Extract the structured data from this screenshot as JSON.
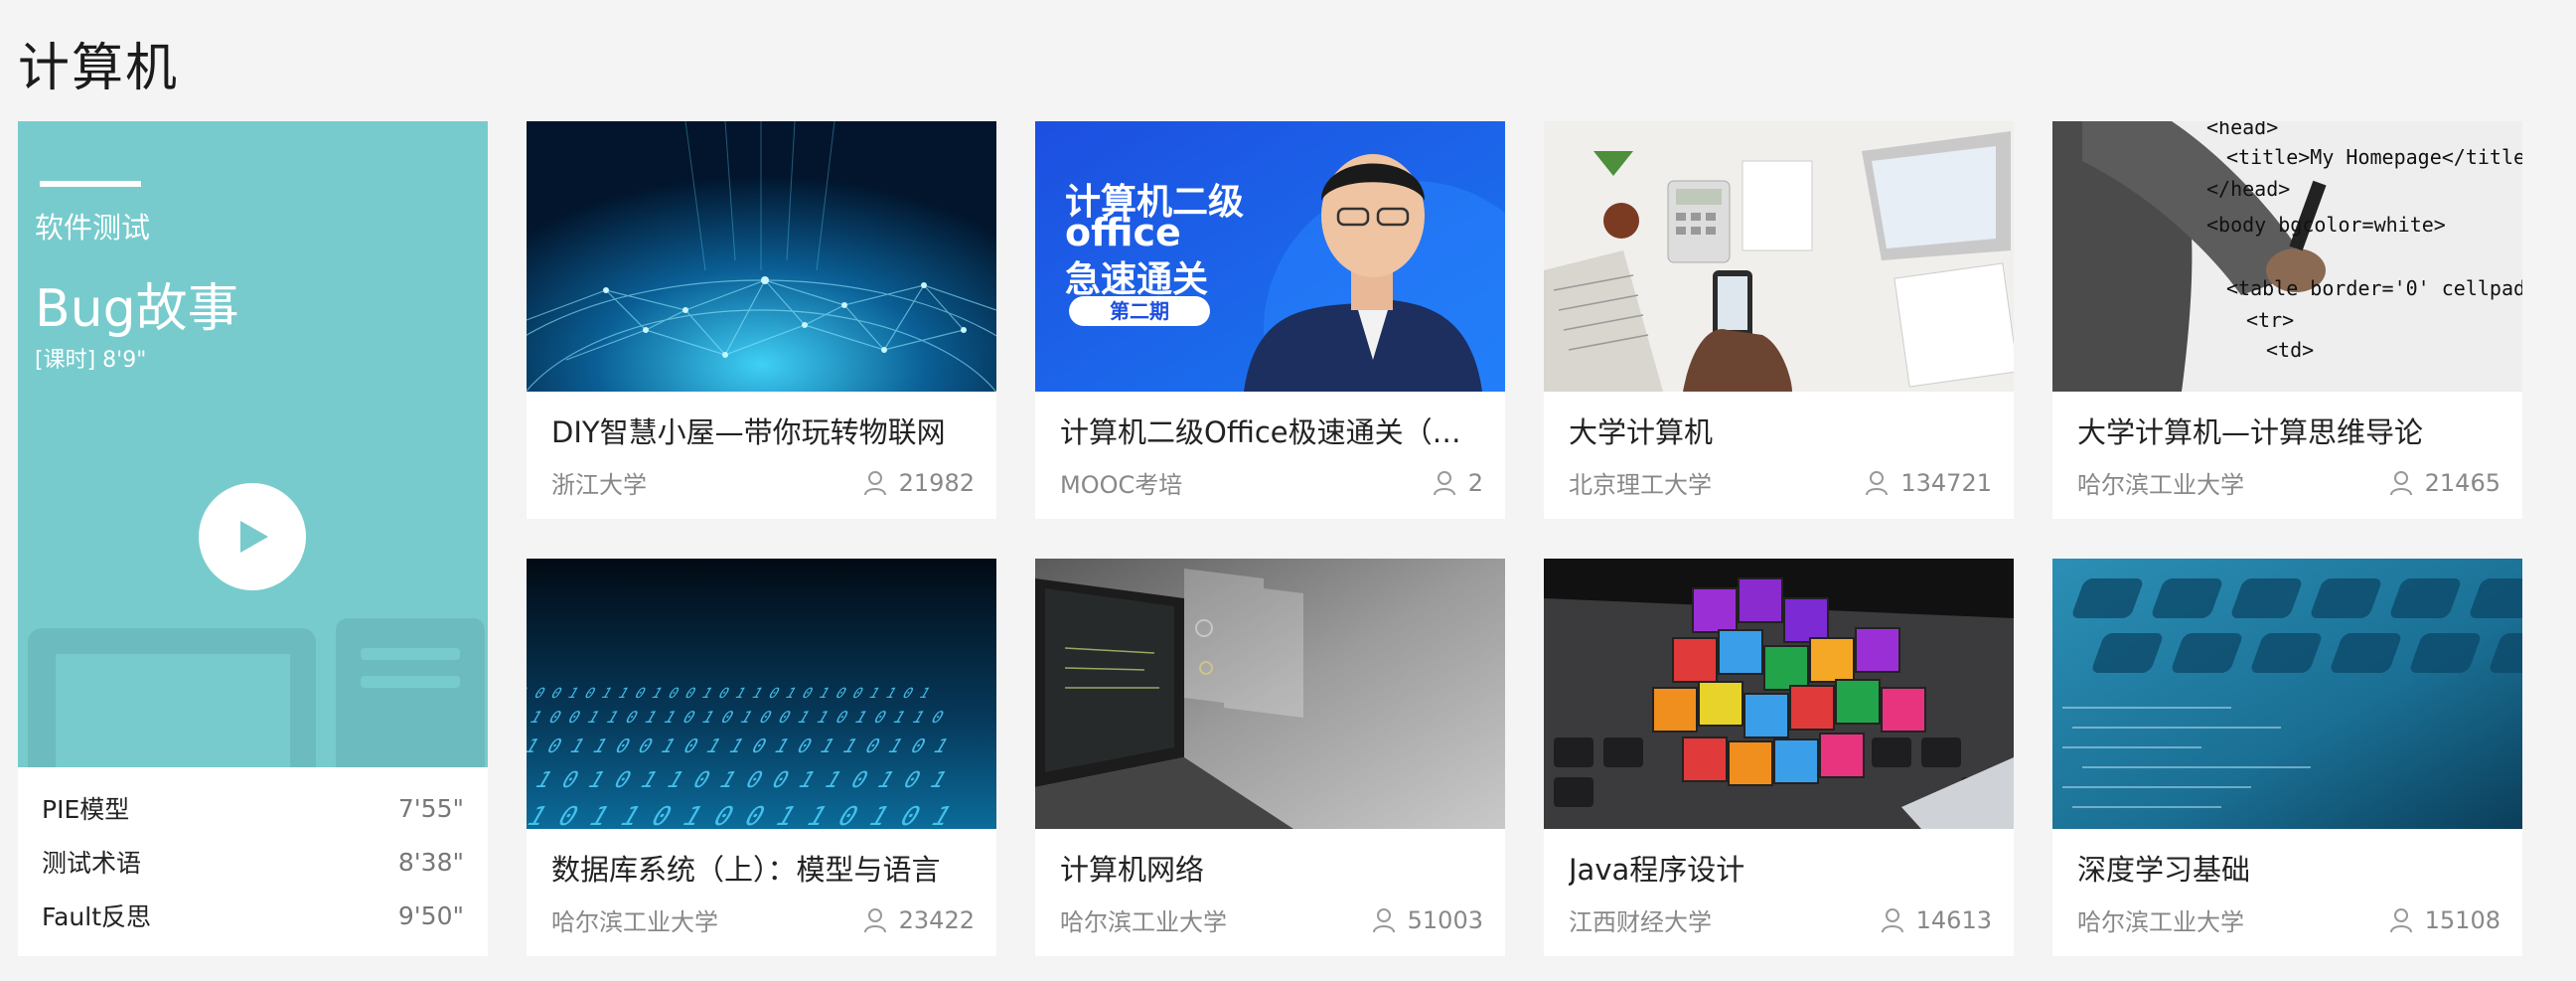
{
  "section": {
    "title": "计算机"
  },
  "feature": {
    "category": "软件测试",
    "title": "Bug故事",
    "duration": "[课时] 8'9\"",
    "items": [
      {
        "label": "PIE模型",
        "duration": "7'55\""
      },
      {
        "label": "测试术语",
        "duration": "8'38\""
      },
      {
        "label": "Fault反思",
        "duration": "9'50\""
      }
    ]
  },
  "courses": [
    {
      "title": "DIY智慧小屋—带你玩转物联网",
      "school": "浙江大学",
      "learners": "21982"
    },
    {
      "title": "计算机二级Office极速通关（第二期）",
      "school": "MOOC考培",
      "learners": "2",
      "thumb_text": {
        "line1": "计算机二级",
        "line2": "office",
        "line3": "急速通关",
        "badge": "第二期"
      }
    },
    {
      "title": "大学计算机",
      "school": "北京理工大学",
      "learners": "134721"
    },
    {
      "title": "大学计算机—计算思维导论",
      "school": "哈尔滨工业大学",
      "learners": "21465",
      "thumb_code": [
        "<head>",
        "<title>My Homepage</title>",
        "</head>",
        "<body bgcolor=white>",
        "<table border='0' cellpadd",
        "<tr>",
        "<td>"
      ]
    },
    {
      "title": "数据库系统（上）：模型与语言",
      "school": "哈尔滨工业大学",
      "learners": "23422"
    },
    {
      "title": "计算机网络",
      "school": "哈尔滨工业大学",
      "learners": "51003"
    },
    {
      "title": "Java程序设计",
      "school": "江西财经大学",
      "learners": "14613"
    },
    {
      "title": "深度学习基础",
      "school": "哈尔滨工业大学",
      "learners": "15108"
    }
  ],
  "colors": {
    "feature_bg": "#77cbcd",
    "page_bg": "#f4f4f4"
  }
}
